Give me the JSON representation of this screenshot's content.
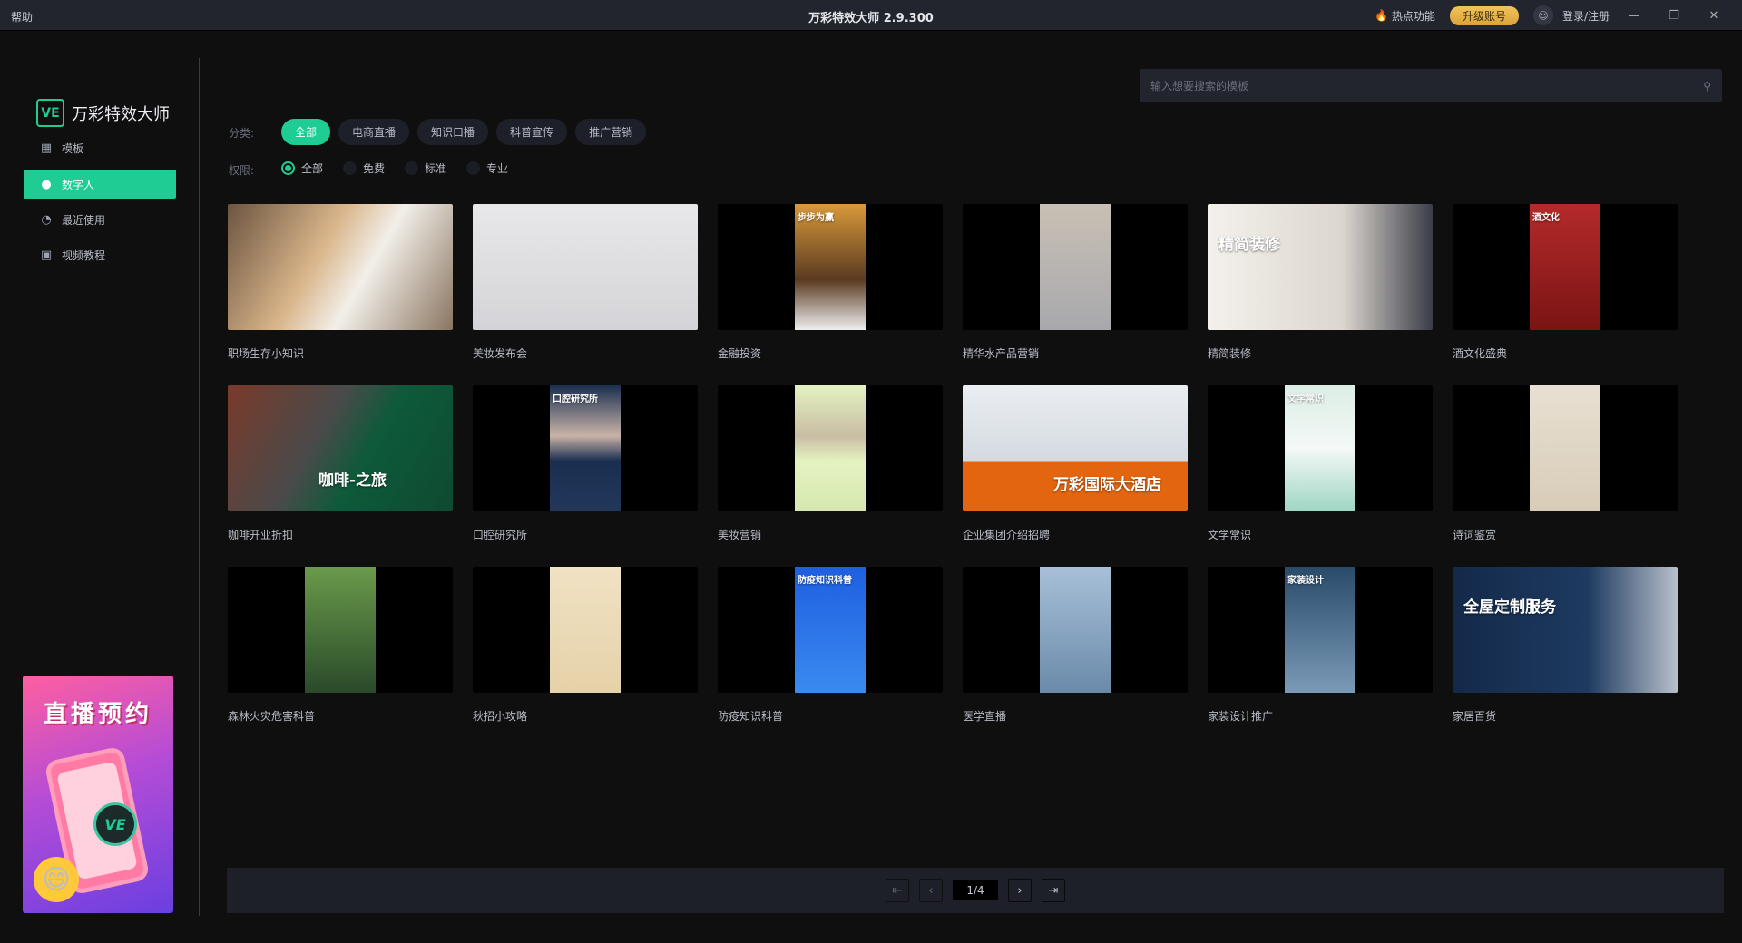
{
  "titlebar": {
    "help": "帮助",
    "title": "万彩特效大师 2.9.300",
    "hot": "热点功能",
    "upgrade": "升级账号",
    "login": "登录/注册",
    "minimize": "—",
    "restore": "❐",
    "close": "✕"
  },
  "sidebar": {
    "logo_mark": "VE",
    "logo_text": "万彩特效大师",
    "items": [
      {
        "label": "模板",
        "icon": "template-icon"
      },
      {
        "label": "数字人",
        "icon": "digital-human-icon",
        "active": true
      },
      {
        "label": "最近使用",
        "icon": "clock-icon"
      },
      {
        "label": "视频教程",
        "icon": "video-tutorial-icon"
      }
    ],
    "promo": {
      "title": "直播预约",
      "badge": "VE"
    }
  },
  "search": {
    "placeholder": "输入想要搜索的模板"
  },
  "filters": {
    "category_label": "分类:",
    "categories": [
      "全部",
      "电商直播",
      "知识口播",
      "科普宣传",
      "推广营销"
    ],
    "active_category": "全部",
    "permission_label": "权限:",
    "permissions": [
      "全部",
      "免费",
      "标准",
      "专业"
    ],
    "active_permission": "全部"
  },
  "accent": "#1ecc94",
  "cards": [
    {
      "title": "职场生存小知识",
      "layout": "wide",
      "bg": "linear-gradient(120deg,#6b5440,#d9b58a 40%,#f2efe9 60%,#8a7560)"
    },
    {
      "title": "美妆发布会",
      "layout": "wide",
      "bg": "linear-gradient(#e8e8ea,#d4d4d8)"
    },
    {
      "title": "金融投资",
      "layout": "tall",
      "bg": "linear-gradient(#d89a3a,#5a3a20 60%,#eee)",
      "overlay": "步步为赢"
    },
    {
      "title": "精华水产品营销",
      "layout": "tall",
      "bg": "linear-gradient(#c8c0b4,#a8a8ac)"
    },
    {
      "title": "精简装修",
      "layout": "wide",
      "bg": "linear-gradient(90deg,#f4f1ec,#dcd6ce 60%,#3a3d48)",
      "overlay": "精简装修"
    },
    {
      "title": "酒文化盛典",
      "layout": "tall",
      "bg": "linear-gradient(#b52a2a,#7a1414)",
      "overlay": "酒文化"
    },
    {
      "title": "咖啡开业折扣",
      "layout": "wide",
      "bg": "linear-gradient(120deg,#7a3a2a,#4a4a4a 40%,#0e5a3a 60%,#0e4a30)",
      "overlay": "咖啡-之旅"
    },
    {
      "title": "口腔研究所",
      "layout": "tall",
      "bg": "linear-gradient(#1a2f50,#c9b3a8 40%,#1a2f50 60%,#22375a)",
      "overlay": "口腔研究所"
    },
    {
      "title": "美妆营销",
      "layout": "tall",
      "bg": "linear-gradient(#e4f2c0,#c9bda4 40%,#e4f2c0 60%,#d6e8b0)"
    },
    {
      "title": "企业集团介绍招聘",
      "layout": "wide",
      "bg": "linear-gradient(#eaeef2 0%,#d4dae0 60%,#e3650f 60%,#e3650f)",
      "overlay": "万彩国际大酒店"
    },
    {
      "title": "文学常识",
      "layout": "tall",
      "bg": "linear-gradient(#dceee6,#f4f8f6 50%,#9ed6c4)",
      "overlay": "文学常识"
    },
    {
      "title": "诗词鉴赏",
      "layout": "tall",
      "bg": "linear-gradient(#e8e0d2,#d8ccb8)"
    },
    {
      "title": "森林火灾危害科普",
      "layout": "tall",
      "bg": "linear-gradient(#6a9a4a,#2a4a2a)"
    },
    {
      "title": "秋招小攻略",
      "layout": "tall",
      "bg": "linear-gradient(#f0e2c4,#e6d2a8)"
    },
    {
      "title": "防疫知识科普",
      "layout": "tall",
      "bg": "linear-gradient(#1e5fe0,#3a8af0)",
      "overlay": "防疫知识科普"
    },
    {
      "title": "医学直播",
      "layout": "tall",
      "bg": "linear-gradient(#a8c0d8,#6a8aaa)"
    },
    {
      "title": "家装设计推广",
      "layout": "tall",
      "bg": "linear-gradient(#2a4a6a,#7a9ab8)",
      "overlay": "家装设计"
    },
    {
      "title": "家居百货",
      "layout": "wide",
      "bg": "linear-gradient(90deg,#13294a,#1e3a60 60%,#b8c0cc)",
      "overlay": "全屋定制服务"
    }
  ],
  "pagination": {
    "first": "⇤",
    "prev": "‹",
    "page": "1/4",
    "next": "›",
    "last": "⇥"
  }
}
